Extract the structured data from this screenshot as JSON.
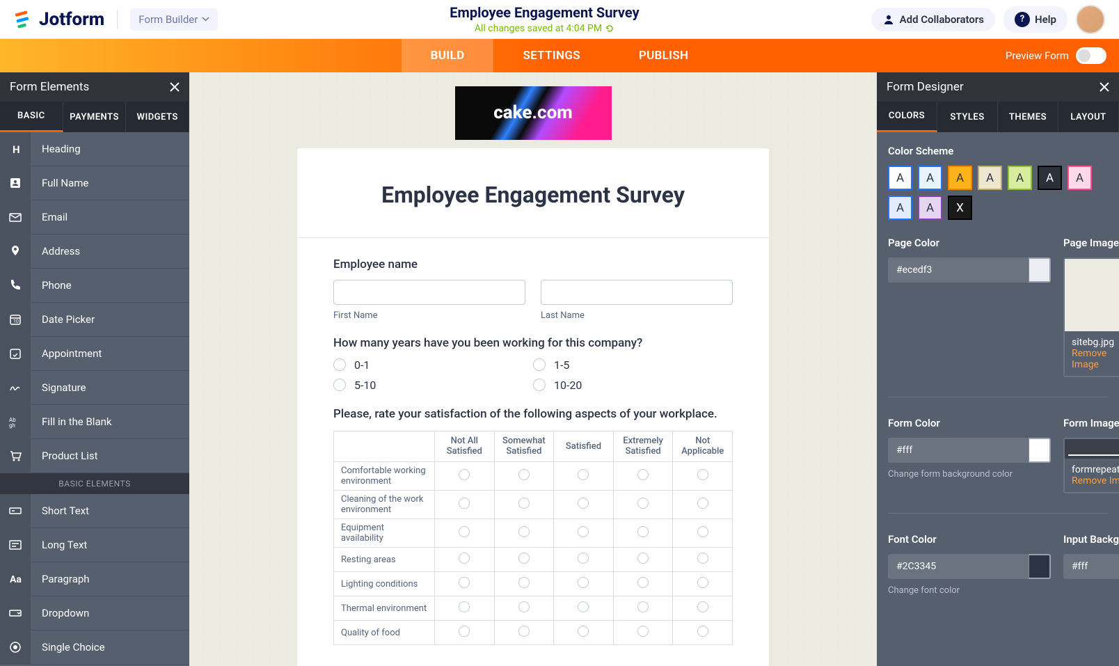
{
  "header": {
    "logo_text": "Jotform",
    "form_builder_label": "Form Builder",
    "form_title": "Employee Engagement Survey",
    "save_status": "All changes saved at 4:04 PM",
    "collab_label": "Add Collaborators",
    "help_label": "Help"
  },
  "nav": {
    "tabs": [
      "BUILD",
      "SETTINGS",
      "PUBLISH"
    ],
    "active": "BUILD",
    "preview_label": "Preview Form"
  },
  "left_panel": {
    "title": "Form Elements",
    "tabs": [
      "BASIC",
      "PAYMENTS",
      "WIDGETS"
    ],
    "active_tab": "BASIC",
    "elements": [
      {
        "icon": "H",
        "label": "Heading"
      },
      {
        "icon": "user",
        "label": "Full Name"
      },
      {
        "icon": "mail",
        "label": "Email"
      },
      {
        "icon": "pin",
        "label": "Address"
      },
      {
        "icon": "phone",
        "label": "Phone"
      },
      {
        "icon": "calendar",
        "label": "Date Picker"
      },
      {
        "icon": "clock",
        "label": "Appointment"
      },
      {
        "icon": "sig",
        "label": "Signature"
      },
      {
        "icon": "blank",
        "label": "Fill in the Blank"
      },
      {
        "icon": "cart",
        "label": "Product List"
      }
    ],
    "section_header": "BASIC ELEMENTS",
    "elements2": [
      {
        "icon": "short",
        "label": "Short Text"
      },
      {
        "icon": "long",
        "label": "Long Text"
      },
      {
        "icon": "para",
        "label": "Paragraph"
      },
      {
        "icon": "drop",
        "label": "Dropdown"
      },
      {
        "icon": "radio",
        "label": "Single Choice"
      }
    ]
  },
  "form": {
    "logo_text": "cake.com",
    "title": "Employee Engagement Survey",
    "q1_label": "Employee name",
    "first_name_sub": "First Name",
    "last_name_sub": "Last Name",
    "q2_label": "How many years have you been working for this company?",
    "q2_options": [
      "0-1",
      "1-5",
      "5-10",
      "10-20"
    ],
    "q3_label": "Please, rate your satisfaction of the following aspects of your workplace.",
    "matrix_cols": [
      "Not All Satisfied",
      "Somewhat Satisfied",
      "Satisfied",
      "Extremely Satisfied",
      "Not Applicable"
    ],
    "matrix_rows": [
      "Comfortable working environment",
      "Cleaning of the work environment",
      "Equipment availability",
      "Resting areas",
      "Lighting conditions",
      "Thermal environment",
      "Quality of food"
    ]
  },
  "right_panel": {
    "title": "Form Designer",
    "tabs": [
      "COLORS",
      "STYLES",
      "THEMES",
      "LAYOUT"
    ],
    "active_tab": "COLORS",
    "color_scheme_label": "Color Scheme",
    "swatches": [
      {
        "bg": "#ffffff",
        "brd": "#2670ff",
        "txt": "A"
      },
      {
        "bg": "#e8f4ff",
        "brd": "#2670ff",
        "txt": "A"
      },
      {
        "bg": "#ffb31a",
        "brd": "#e88900",
        "txt": "A"
      },
      {
        "bg": "#eee6cf",
        "brd": "#bda86f",
        "txt": "A"
      },
      {
        "bg": "#d8ec9e",
        "brd": "#8bbf3d",
        "txt": "A"
      },
      {
        "bg": "#2c3038",
        "brd": "#000",
        "txt": "A",
        "fg": "#fff"
      },
      {
        "bg": "#ffd9e8",
        "brd": "#ff4d8d",
        "txt": "A"
      },
      {
        "bg": "#e3ecff",
        "brd": "#2670ff",
        "txt": "A"
      },
      {
        "bg": "#e5d5f2",
        "brd": "#8b3fbf",
        "txt": "A"
      },
      {
        "bg": "#1a1a1a",
        "brd": "#000",
        "txt": "X",
        "fg": "#fff"
      }
    ],
    "page_color_label": "Page Color",
    "page_color_value": "#ecedf3",
    "page_image_label": "Page Image",
    "page_image_name": "sitebg.jpg",
    "remove_image_label": "Remove Image",
    "form_color_label": "Form Color",
    "form_color_value": "#fff",
    "form_color_helper": "Change form background color",
    "form_image_label": "Form Image",
    "form_image_name": "formrepeat.png",
    "font_color_label": "Font Color",
    "font_color_value": "#2C3345",
    "font_color_helper": "Change font color",
    "input_bg_label": "Input Background",
    "input_bg_value": "#fff"
  }
}
